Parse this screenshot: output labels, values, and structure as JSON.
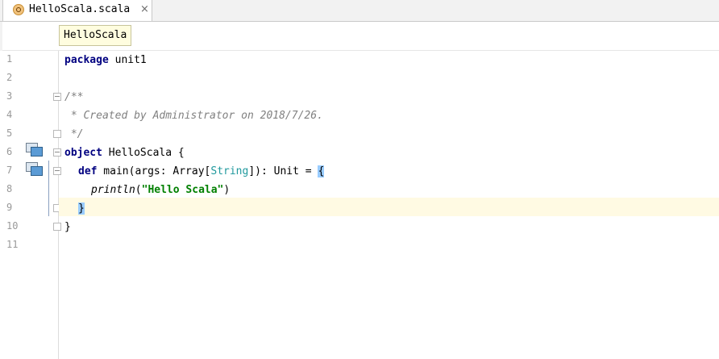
{
  "tab": {
    "icon": "scala-object-icon",
    "label": "HelloScala.scala",
    "close_label": "×"
  },
  "breadcrumb": {
    "label": "HelloScala"
  },
  "editor": {
    "line_numbers": [
      "1",
      "2",
      "3",
      "4",
      "5",
      "6",
      "7",
      "8",
      "9",
      "10",
      "11"
    ],
    "current_line": 9,
    "lines": {
      "l1": {
        "keyword": "package",
        "rest": " unit1"
      },
      "l3": {
        "text": "/**"
      },
      "l4": {
        "text": " * Created by Administrator on 2018/7/26."
      },
      "l5": {
        "text": " */"
      },
      "l6": {
        "keyword": "object",
        "rest": " HelloScala {"
      },
      "l7": {
        "keyword": "def",
        "part1": " main(args: Array[",
        "type": "String",
        "part2": "]): Unit = ",
        "brace": "{"
      },
      "l8": {
        "fn": "println",
        "open": "(",
        "string": "\"Hello Scala\"",
        "close": ")"
      },
      "l9": {
        "brace": "}"
      },
      "l10": {
        "text": "}"
      }
    }
  },
  "colors": {
    "keyword": "#000080",
    "comment": "#808080",
    "type": "#20999d",
    "string": "#008000",
    "current_line_bg": "#fffae3",
    "brace_match_bg": "#99ccff"
  }
}
